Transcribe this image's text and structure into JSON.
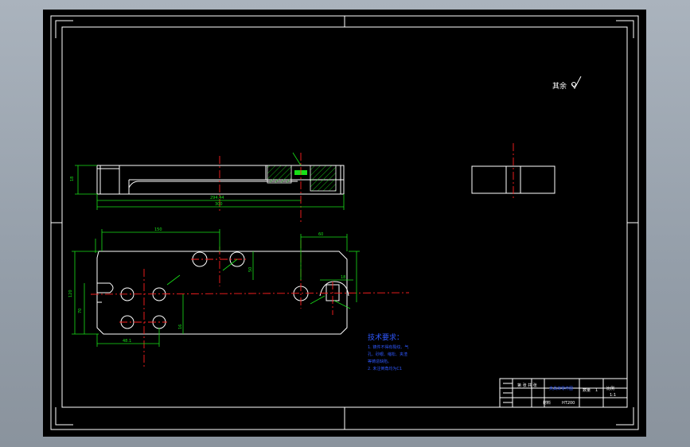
{
  "drawing": {
    "roughness_note": "其余",
    "colors": {
      "sheet": "#000000",
      "outline": "#ffffff",
      "dimension": "#18e018",
      "centerline": "#ff2020",
      "notes": "#2f58ff"
    },
    "dimensions": {
      "top_view_width": "150",
      "top_view_right": "60",
      "side_height": "120",
      "side_sub": "70",
      "front_inner": "294.44",
      "front_overall": "300",
      "hole_depth": "50",
      "slot_width": "16",
      "small_left": "18",
      "small_right": "18",
      "spacing": "48.1"
    },
    "tech_requirements": {
      "title": "技术要求：",
      "lines": [
        "1. 铸件不得有裂纹、气",
        "孔、砂眼、缩松、夹渣",
        "等铸造缺陷。",
        "2. 未注倒角均为C1"
      ]
    },
    "title_block": {
      "drawing_name": "夹具体零件图",
      "scale_label": "比例",
      "scale_value": "1:1",
      "qty_label": "数量",
      "qty_value": "1",
      "material_label": "材料",
      "material_value": "HT200",
      "sheet_label": "第 张 共 张"
    }
  }
}
